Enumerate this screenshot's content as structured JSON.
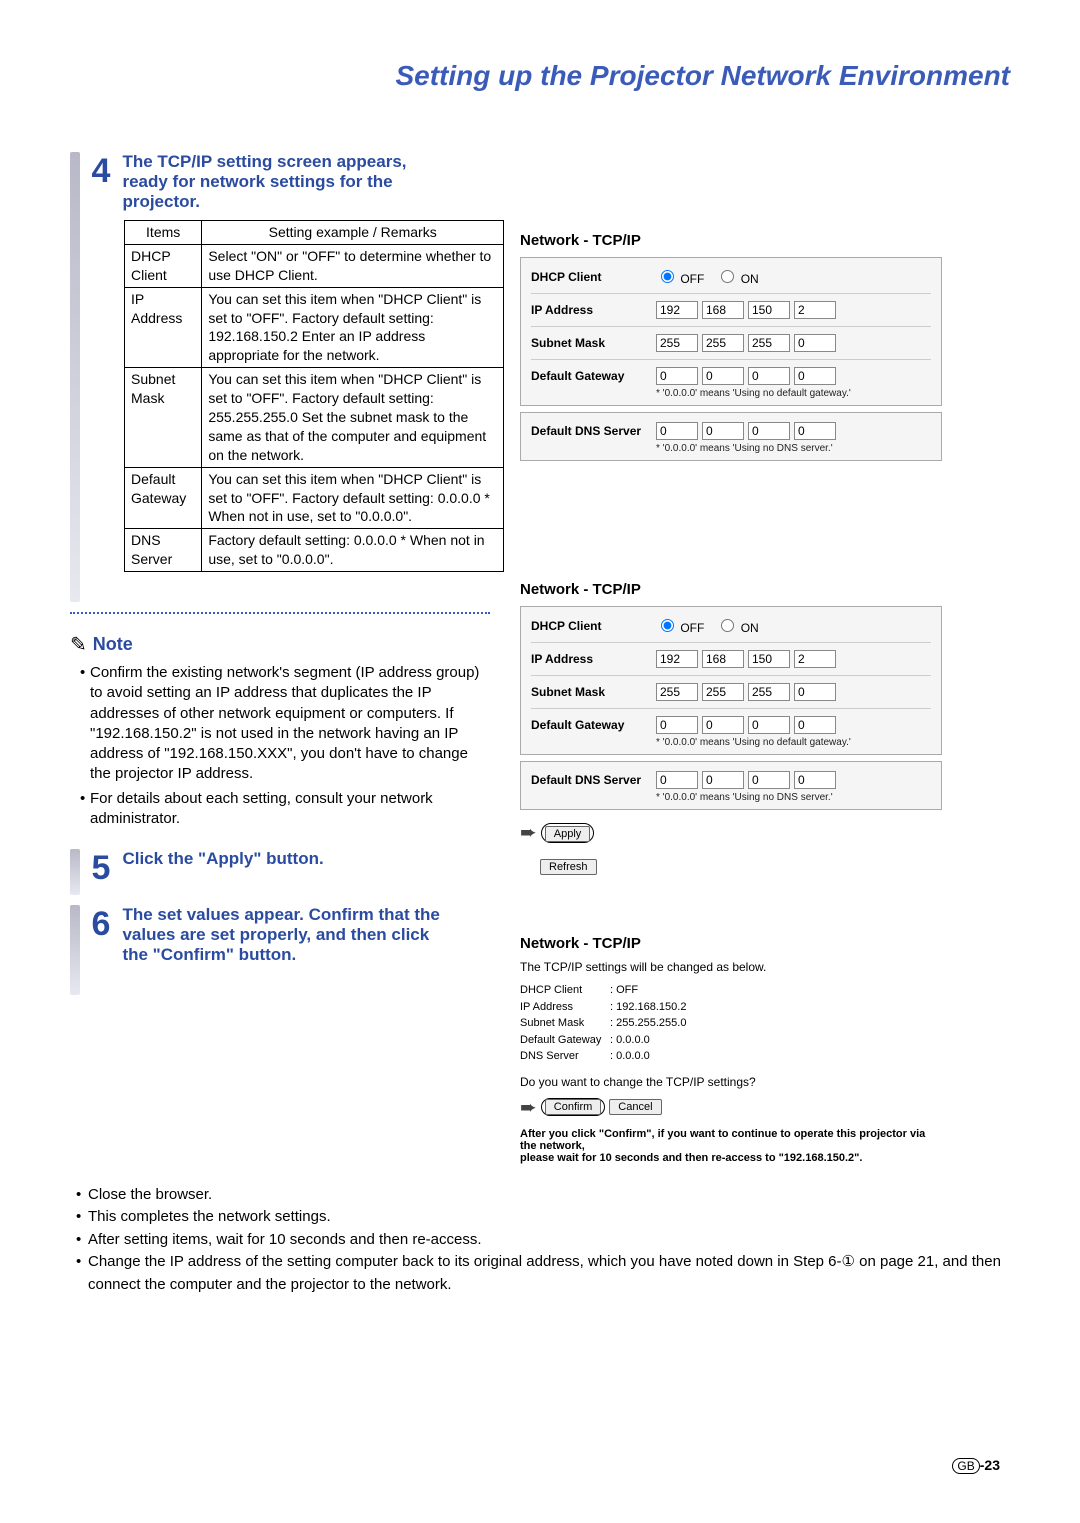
{
  "header": {
    "title": "Setting up the Projector Network Environment"
  },
  "step4": {
    "number": "4",
    "heading": "The TCP/IP setting screen appears, ready for network settings for the projector.",
    "table": {
      "head": {
        "items": "Items",
        "remarks": "Setting example / Remarks"
      },
      "rows": [
        {
          "item": "DHCP Client",
          "remark": "Select \"ON\" or \"OFF\" to determine whether to use DHCP Client."
        },
        {
          "item": "IP Address",
          "remark": "You can set this item when \"DHCP Client\" is set to \"OFF\". Factory default setting: 192.168.150.2 Enter an IP address appropriate for the network."
        },
        {
          "item": "Subnet Mask",
          "remark": "You can set this item when \"DHCP Client\" is set to \"OFF\". Factory default setting: 255.255.255.0 Set the subnet mask to the same as that of the computer and equipment on the network."
        },
        {
          "item": "Default Gateway",
          "remark": "You can set this item when \"DHCP Client\" is set to \"OFF\". Factory default setting: 0.0.0.0 * When not in use, set to \"0.0.0.0\"."
        },
        {
          "item": "DNS Server",
          "remark": "Factory default setting: 0.0.0.0 * When not in use, set to \"0.0.0.0\"."
        }
      ]
    }
  },
  "note": {
    "label": "Note",
    "items": [
      "Confirm the existing network's segment (IP address group) to avoid setting an IP address that duplicates the IP addresses of other network equipment or computers. If \"192.168.150.2\" is not used in the network having an IP address of \"192.168.150.XXX\", you don't have to change the projector IP address.",
      "For details about each setting, consult your network administrator."
    ]
  },
  "step5": {
    "number": "5",
    "heading": "Click the \"Apply\" button."
  },
  "step6": {
    "number": "6",
    "heading": "The set values appear. Confirm that the values are set properly, and then click the \"Confirm\" button."
  },
  "panels": {
    "title": "Network - TCP/IP",
    "labels": {
      "dhcp": "DHCP Client",
      "ip": "IP Address",
      "subnet": "Subnet Mask",
      "gateway": "Default Gateway",
      "dns": "Default DNS Server",
      "off": "OFF",
      "on": "ON"
    },
    "values": {
      "ip": [
        "192",
        "168",
        "150",
        "2"
      ],
      "subnet": [
        "255",
        "255",
        "255",
        "0"
      ],
      "gateway": [
        "0",
        "0",
        "0",
        "0"
      ],
      "dns": [
        "0",
        "0",
        "0",
        "0"
      ]
    },
    "gateway_note": "* '0.0.0.0' means 'Using no default gateway.'",
    "dns_note": "* '0.0.0.0' means 'Using no DNS server.'",
    "apply": "Apply",
    "refresh": "Refresh"
  },
  "confirm": {
    "title": "Network - TCP/IP",
    "intro": "The TCP/IP settings will be changed as below.",
    "rows": {
      "dhcp_l": "DHCP Client",
      "dhcp_v": ": OFF",
      "ip_l": "IP Address",
      "ip_v": ": 192.168.150.2",
      "sm_l": "Subnet Mask",
      "sm_v": ": 255.255.255.0",
      "gw_l": "Default Gateway",
      "gw_v": ": 0.0.0.0",
      "dns_l": "DNS Server",
      "dns_v": ": 0.0.0.0"
    },
    "question": "Do you want to change the TCP/IP settings?",
    "confirm_btn": "Confirm",
    "cancel_btn": "Cancel",
    "warn1": "After you click \"Confirm\", if you want to continue to operate this projector via the network,",
    "warn2": "please wait for 10 seconds and then re-access to \"192.168.150.2\"."
  },
  "bottom": [
    "Close the browser.",
    "This completes the network settings.",
    "After setting items, wait for 10 seconds and then re-access.",
    "Change the IP address of the setting computer back to its original address, which you have noted down in Step 6-① on page 21, and then connect the computer and the projector to the network."
  ],
  "pagenum": {
    "gb": "GB",
    "num": "-23"
  }
}
